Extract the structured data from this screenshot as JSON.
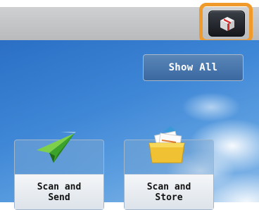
{
  "header": {
    "device_status_icon": "device-status-icon"
  },
  "main": {
    "show_all_label": "Show All",
    "functions": [
      {
        "label": "Scan and\nSend",
        "icon": "paper-plane-icon"
      },
      {
        "label": "Scan and\nStore",
        "icon": "folder-documents-icon"
      }
    ]
  },
  "colors": {
    "highlight": "#ef9a2a",
    "sky": "#3e86d6",
    "topbar": "#c4c5c7"
  }
}
